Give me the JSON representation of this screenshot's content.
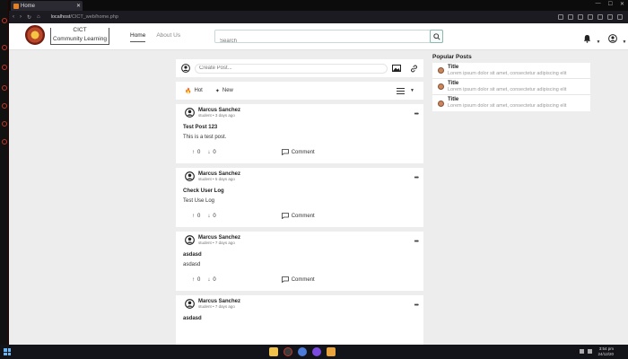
{
  "browser": {
    "tab_title": "Home",
    "url_host": "localhost",
    "url_path": "/CICT_web/home.php"
  },
  "nav": {
    "brand_line1": "CICT",
    "brand_line2": "Community Learning",
    "home": "Home",
    "about": "About Us",
    "search_placeholder": "Search"
  },
  "create_post": {
    "placeholder": "Create Post..."
  },
  "sort": {
    "hot": "Hot",
    "new": "New"
  },
  "posts": [
    {
      "author": "Marcus Sanchez",
      "meta": "student • 3 days ago",
      "title": "Test Post 123",
      "body": "This is a test post.",
      "up": "0",
      "down": "0",
      "comment": "Comment"
    },
    {
      "author": "Marcus Sanchez",
      "meta": "student • 5 days ago",
      "title": "Check User Log",
      "body": "Test Use Log",
      "up": "0",
      "down": "0",
      "comment": "Comment"
    },
    {
      "author": "Marcus Sanchez",
      "meta": "student • 7 days ago",
      "title": "asdasd",
      "body": "asdasd",
      "up": "0",
      "down": "0",
      "comment": "Comment"
    },
    {
      "author": "Marcus Sanchez",
      "meta": "student • 7 days ago",
      "title": "asdasd",
      "body": "",
      "up": "",
      "down": "",
      "comment": ""
    }
  ],
  "popular": {
    "heading": "Popular Posts",
    "items": [
      {
        "title": "Title",
        "desc": "Lorem ipsum dolor sit amet, consectetur adipiscing elit"
      },
      {
        "title": "Title",
        "desc": "Lorem ipsum dolor sit amet, consectetur adipiscing elit"
      },
      {
        "title": "Title",
        "desc": "Lorem ipsum dolor sit amet, consectetur adipiscing elit"
      }
    ]
  },
  "taskbar": {
    "time": "3:54 pm",
    "date": "24/12/20"
  },
  "colors": {
    "page_bg": "#ededed",
    "search_border": "#8cb8af",
    "avatar": "#c9875f"
  }
}
